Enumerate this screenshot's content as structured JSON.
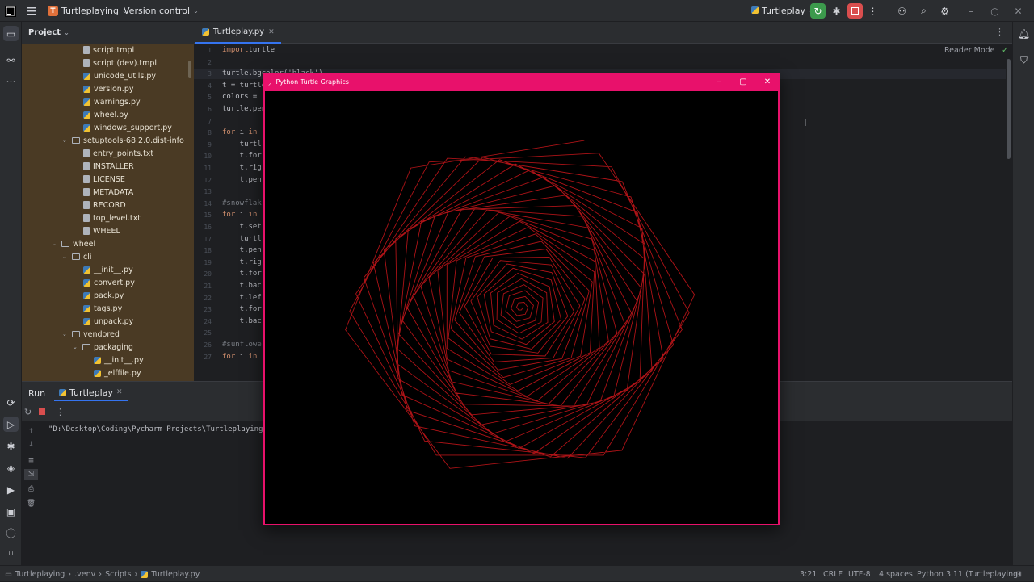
{
  "titlebar": {
    "project_badge": "T",
    "project_name": "Turtleplaying",
    "vcs": "Version control",
    "run_config": "Turtleplay",
    "icons": [
      "logo-icon",
      "hamburger-icon",
      "run-icon",
      "debug-icon",
      "stop-icon",
      "more-icon",
      "add-user-icon",
      "search-icon",
      "settings-icon",
      "minimize-icon",
      "maximize-icon",
      "close-icon"
    ]
  },
  "project_panel": {
    "title": "Project",
    "items": [
      {
        "label": "script.tmpl",
        "type": "file",
        "indent": 3
      },
      {
        "label": "script (dev).tmpl",
        "type": "file",
        "indent": 3
      },
      {
        "label": "unicode_utils.py",
        "type": "py",
        "indent": 3
      },
      {
        "label": "version.py",
        "type": "py",
        "indent": 3
      },
      {
        "label": "warnings.py",
        "type": "py",
        "indent": 3
      },
      {
        "label": "wheel.py",
        "type": "py",
        "indent": 3
      },
      {
        "label": "windows_support.py",
        "type": "py",
        "indent": 3
      },
      {
        "label": "setuptools-68.2.0.dist-info",
        "type": "dir",
        "indent": 2,
        "expanded": true
      },
      {
        "label": "entry_points.txt",
        "type": "file",
        "indent": 3
      },
      {
        "label": "INSTALLER",
        "type": "file",
        "indent": 3
      },
      {
        "label": "LICENSE",
        "type": "file",
        "indent": 3
      },
      {
        "label": "METADATA",
        "type": "file",
        "indent": 3
      },
      {
        "label": "RECORD",
        "type": "file",
        "indent": 3
      },
      {
        "label": "top_level.txt",
        "type": "file",
        "indent": 3
      },
      {
        "label": "WHEEL",
        "type": "file",
        "indent": 3
      },
      {
        "label": "wheel",
        "type": "dir",
        "indent": 1,
        "expanded": true
      },
      {
        "label": "cli",
        "type": "dir",
        "indent": 2,
        "expanded": true
      },
      {
        "label": "__init__.py",
        "type": "py",
        "indent": 3
      },
      {
        "label": "convert.py",
        "type": "py",
        "indent": 3
      },
      {
        "label": "pack.py",
        "type": "py",
        "indent": 3
      },
      {
        "label": "tags.py",
        "type": "py",
        "indent": 3
      },
      {
        "label": "unpack.py",
        "type": "py",
        "indent": 3
      },
      {
        "label": "vendored",
        "type": "dir",
        "indent": 2,
        "expanded": true
      },
      {
        "label": "packaging",
        "type": "dir",
        "indent": 3,
        "expanded": true
      },
      {
        "label": "__init__.py",
        "type": "py",
        "indent": 4
      },
      {
        "label": "_elffile.py",
        "type": "py",
        "indent": 4
      }
    ]
  },
  "editor": {
    "tab_label": "Turtleplay.py",
    "reader_mode": "Reader Mode",
    "lines": [
      {
        "n": "1",
        "parts": [
          [
            "kw",
            "import"
          ],
          [
            "",
            "turtle"
          ]
        ]
      },
      {
        "n": "2",
        "parts": []
      },
      {
        "n": "3",
        "parts": [
          [
            "",
            "turtle.bgcolor('black')"
          ]
        ]
      },
      {
        "n": "4",
        "parts": [
          [
            "",
            "t = turtle"
          ]
        ]
      },
      {
        "n": "5",
        "parts": [
          [
            "",
            "colors = "
          ]
        ]
      },
      {
        "n": "6",
        "parts": [
          [
            "",
            "turtle.pen"
          ]
        ]
      },
      {
        "n": "7",
        "parts": []
      },
      {
        "n": "8",
        "parts": [
          [
            "kw",
            "for"
          ],
          [
            "",
            " i "
          ],
          [
            "kw",
            "in"
          ]
        ]
      },
      {
        "n": "9",
        "parts": [
          [
            "",
            "    turtl"
          ]
        ]
      },
      {
        "n": "10",
        "parts": [
          [
            "",
            "    t.for"
          ]
        ]
      },
      {
        "n": "11",
        "parts": [
          [
            "",
            "    t.rig"
          ]
        ]
      },
      {
        "n": "12",
        "parts": [
          [
            "",
            "    t.pen"
          ]
        ]
      },
      {
        "n": "13",
        "parts": []
      },
      {
        "n": "14",
        "parts": [
          [
            "cm",
            "#snowflak"
          ]
        ]
      },
      {
        "n": "15",
        "parts": [
          [
            "kw",
            "for"
          ],
          [
            "",
            " i "
          ],
          [
            "kw",
            "in"
          ]
        ]
      },
      {
        "n": "16",
        "parts": [
          [
            "",
            "    t.set"
          ]
        ]
      },
      {
        "n": "17",
        "parts": [
          [
            "",
            "    turtl"
          ]
        ]
      },
      {
        "n": "18",
        "parts": [
          [
            "",
            "    t.pen"
          ]
        ]
      },
      {
        "n": "19",
        "parts": [
          [
            "",
            "    t.rig"
          ]
        ]
      },
      {
        "n": "20",
        "parts": [
          [
            "",
            "    t.for"
          ]
        ]
      },
      {
        "n": "21",
        "parts": [
          [
            "",
            "    t.bac"
          ]
        ]
      },
      {
        "n": "22",
        "parts": [
          [
            "",
            "    t.lef"
          ]
        ]
      },
      {
        "n": "23",
        "parts": [
          [
            "",
            "    t.for"
          ]
        ]
      },
      {
        "n": "24",
        "parts": [
          [
            "",
            "    t.bac"
          ]
        ]
      },
      {
        "n": "25",
        "parts": []
      },
      {
        "n": "26",
        "parts": [
          [
            "cm",
            "#sunflowe"
          ]
        ]
      },
      {
        "n": "27",
        "parts": [
          [
            "kw",
            "for"
          ],
          [
            "",
            " i "
          ],
          [
            "kw",
            "in"
          ]
        ]
      }
    ]
  },
  "run_panel": {
    "tab_run": "Run",
    "tab_config": "Turtleplay",
    "console_line": "\"D:\\Desktop\\Coding\\Pycharm Projects\\Turtleplaying\\"
  },
  "turtle_window": {
    "title": "Python Turtle Graphics",
    "line_color": "#c0151a",
    "bg_color": "#000000"
  },
  "statusbar": {
    "breadcrumb": [
      "Turtleplaying",
      ".venv",
      "Scripts",
      "Turtleplay.py"
    ],
    "position": "3:21",
    "line_sep": "CRLF",
    "encoding": "UTF-8",
    "indent": "4 spaces",
    "interpreter": "Python 3.11 (Turtleplaying)"
  },
  "colors": {
    "accent": "#3574f0",
    "turtle_frame": "#e8116b",
    "project_bg": "#4a3a24"
  }
}
